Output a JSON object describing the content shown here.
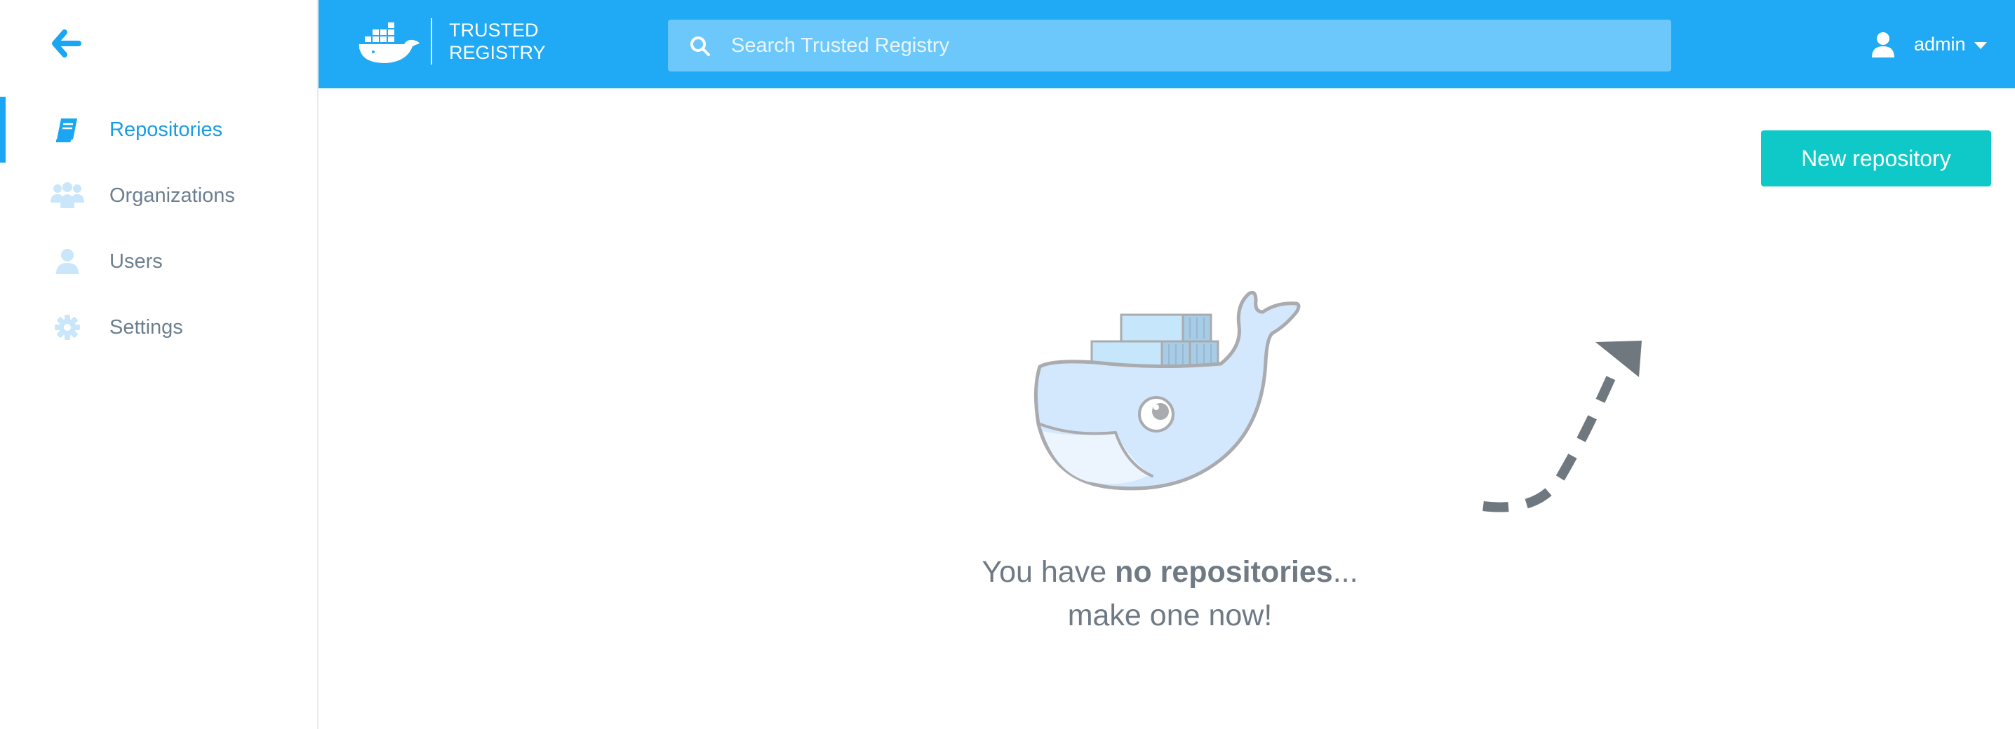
{
  "sidebar": {
    "back_icon": "arrow-left-icon",
    "items": [
      {
        "label": "Repositories",
        "icon": "book-icon",
        "active": true
      },
      {
        "label": "Organizations",
        "icon": "group-icon",
        "active": false
      },
      {
        "label": "Users",
        "icon": "user-icon",
        "active": false
      },
      {
        "label": "Settings",
        "icon": "gear-icon",
        "active": false
      }
    ]
  },
  "header": {
    "logo_line1": "TRUSTED",
    "logo_line2": "REGISTRY",
    "search_placeholder": "Search Trusted Registry",
    "user_name": "admin"
  },
  "main": {
    "new_repo_label": "New repository",
    "empty_prefix": "You have ",
    "empty_bold": "no repositories",
    "empty_suffix": "...",
    "empty_line2": "make one now!"
  },
  "colors": {
    "topbar": "#20a9f4",
    "accent": "#1aa6f2",
    "button": "#0ec9c8",
    "nav_text": "#6d7f8f",
    "nav_icon_inactive": "#c9e6fb"
  }
}
